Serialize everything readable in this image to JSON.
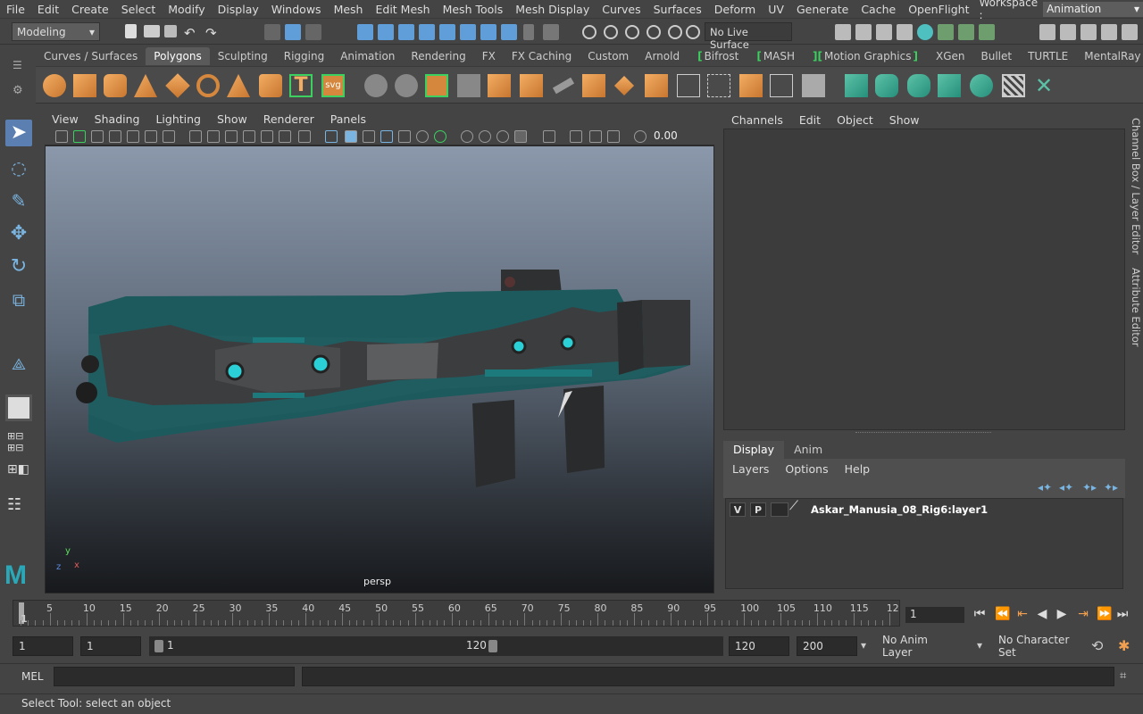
{
  "menubar": {
    "items": [
      "File",
      "Edit",
      "Create",
      "Select",
      "Modify",
      "Display",
      "Windows",
      "Mesh",
      "Edit Mesh",
      "Mesh Tools",
      "Mesh Display",
      "Curves",
      "Surfaces",
      "Deform",
      "UV",
      "Generate",
      "Cache",
      "OpenFlight"
    ],
    "workspace_label": "Workspace :",
    "workspace_value": "Animation"
  },
  "statusline": {
    "mode": "Modeling",
    "live_surface": "No Live Surface"
  },
  "shelf": {
    "tabs": [
      "Curves / Surfaces",
      "Polygons",
      "Sculpting",
      "Rigging",
      "Animation",
      "Rendering",
      "FX",
      "FX Caching",
      "Custom",
      "Arnold",
      "Bifrost",
      "MASH",
      "Motion Graphics",
      "XGen",
      "Bullet",
      "TURTLE",
      "MentalRay"
    ],
    "active": "Polygons",
    "text_icon": "T",
    "svg_icon": "svg"
  },
  "viewport": {
    "menus": [
      "View",
      "Shading",
      "Lighting",
      "Show",
      "Renderer",
      "Panels"
    ],
    "field_value": "0.00",
    "camera_label": "persp",
    "axis_y": "y",
    "axis_x": "x",
    "axis_z": "z"
  },
  "channelbox": {
    "menus": [
      "Channels",
      "Edit",
      "Object",
      "Show"
    ],
    "side_tab_1": "Channel Box / Layer Editor",
    "side_tab_2": "Attribute Editor"
  },
  "layers": {
    "tabs": [
      "Display",
      "Anim"
    ],
    "active_tab": "Display",
    "menus": [
      "Layers",
      "Options",
      "Help"
    ],
    "row": {
      "v": "V",
      "p": "P",
      "name": "Askar_Manusia_08_Rig6:layer1"
    }
  },
  "timeline": {
    "ticks": [
      "5",
      "10",
      "15",
      "20",
      "25",
      "30",
      "35",
      "40",
      "45",
      "50",
      "55",
      "60",
      "65",
      "70",
      "75",
      "80",
      "85",
      "90",
      "95",
      "100",
      "105",
      "110",
      "115",
      "12"
    ],
    "start_marker": "1",
    "current_frame": "1"
  },
  "range": {
    "start": "1",
    "anim_start": "1",
    "slider_start": "1",
    "slider_end": "120",
    "end": "120",
    "anim_end": "200",
    "anim_layer": "No Anim Layer",
    "character_set": "No Character Set"
  },
  "cmdline": {
    "label": "MEL"
  },
  "helpline": {
    "text": "Select Tool: select an object"
  }
}
